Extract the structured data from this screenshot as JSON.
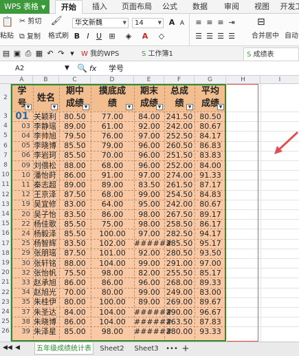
{
  "app": {
    "title": "WPS 表格"
  },
  "menu": {
    "tabs": [
      "开始",
      "插入",
      "页面布局",
      "公式",
      "数据",
      "审阅",
      "视图",
      "开发工"
    ]
  },
  "ribbon": {
    "cut": "剪切",
    "paste": "粘贴",
    "copy": "复制",
    "format_painter": "格式刷",
    "font_name": "华文新魏",
    "font_size": "14",
    "merge_center": "合并居中",
    "auto": "自动"
  },
  "quickbar": {
    "doc_tabs": [
      "我的WPS",
      "工作簿1",
      "成绩表Excel.xls"
    ]
  },
  "formula_bar": {
    "cell_ref": "A2",
    "fx": "fx",
    "content": "学号"
  },
  "columns": [
    "A",
    "B",
    "C",
    "D",
    "E",
    "F",
    "G",
    "H",
    "I"
  ],
  "table": {
    "headers": [
      {
        "line1": "学",
        "line2": "号"
      },
      {
        "line1": "姓名",
        "line2": ""
      },
      {
        "line1": "期中",
        "line2": "成绩"
      },
      {
        "line1": "摸底成",
        "line2": "绩"
      },
      {
        "line1": "期末",
        "line2": "成绩"
      },
      {
        "line1": "总成",
        "line2": "绩"
      },
      {
        "line1": "平均",
        "line2": "成绩"
      }
    ],
    "header_row_label": "2",
    "rows": [
      {
        "r": "3",
        "no": "01",
        "name": "关颖利",
        "c": "80.50",
        "d": "77.00",
        "e": "84.00",
        "f": "241.50",
        "g": "80.50"
      },
      {
        "r": "4",
        "no": "03",
        "name": "李静瑶",
        "c": "89.00",
        "d": "61.00",
        "e": "92.00",
        "f": "242.00",
        "g": "80.67"
      },
      {
        "r": "5",
        "no": "04",
        "name": "李帅旭",
        "c": "79.50",
        "d": "76.00",
        "e": "97.00",
        "f": "252.50",
        "g": "84.17"
      },
      {
        "r": "6",
        "no": "05",
        "name": "李晓博",
        "c": "85.50",
        "d": "79.00",
        "e": "96.00",
        "f": "260.50",
        "g": "86.83"
      },
      {
        "r": "7",
        "no": "06",
        "name": "李岩珂",
        "c": "85.50",
        "d": "70.00",
        "e": "96.00",
        "f": "251.50",
        "g": "83.83"
      },
      {
        "r": "8",
        "no": "09",
        "name": "刘偎松",
        "c": "88.00",
        "d": "68.00",
        "e": "96.00",
        "f": "252.00",
        "g": "84.00"
      },
      {
        "r": "10",
        "no": "10",
        "name": "潘怡莳",
        "c": "86.00",
        "d": "91.00",
        "e": "97.00",
        "f": "274.00",
        "g": "91.33"
      },
      {
        "r": "11",
        "no": "11",
        "name": "秦志超",
        "c": "89.00",
        "d": "89.00",
        "e": "83.50",
        "f": "261.50",
        "g": "87.17"
      },
      {
        "r": "12",
        "no": "12",
        "name": "王京泽",
        "c": "87.50",
        "d": "68.00",
        "e": "99.00",
        "f": "254.50",
        "g": "84.83"
      },
      {
        "r": "13",
        "no": "19",
        "name": "吴宜修",
        "c": "83.00",
        "d": "64.00",
        "e": "95.00",
        "f": "242.00",
        "g": "80.67"
      },
      {
        "r": "14",
        "no": "20",
        "name": "吴子怡",
        "c": "83.50",
        "d": "86.00",
        "e": "98.00",
        "f": "267.50",
        "g": "89.17"
      },
      {
        "r": "15",
        "no": "22",
        "name": "杨佳歌",
        "c": "85.50",
        "d": "75.00",
        "e": "98.00",
        "f": "258.50",
        "g": "86.17"
      },
      {
        "r": "16",
        "no": "24",
        "name": "杨毅泽",
        "c": "85.50",
        "d": "100.00",
        "e": "97.00",
        "f": "282.50",
        "g": "94.17"
      },
      {
        "r": "17",
        "no": "25",
        "name": "杨智辉",
        "c": "83.50",
        "d": "102.00",
        "e": "######",
        "f": "285.50",
        "g": "95.17"
      },
      {
        "r": "18",
        "no": "29",
        "name": "张朋瑶",
        "c": "87.50",
        "d": "101.00",
        "e": "92.00",
        "f": "280.50",
        "g": "93.50"
      },
      {
        "r": "19",
        "no": "30",
        "name": "张轩铭",
        "c": "88.00",
        "d": "104.00",
        "e": "99.00",
        "f": "291.00",
        "g": "97.00"
      },
      {
        "r": "20",
        "no": "32",
        "name": "张怡帆",
        "c": "75.50",
        "d": "98.00",
        "e": "82.00",
        "f": "255.50",
        "g": "85.17"
      },
      {
        "r": "21",
        "no": "33",
        "name": "赵承旭",
        "c": "86.00",
        "d": "86.00",
        "e": "96.00",
        "f": "268.00",
        "g": "89.33"
      },
      {
        "r": "22",
        "no": "34",
        "name": "赵旭光",
        "c": "70.00",
        "d": "80.00",
        "e": "99.00",
        "f": "249.00",
        "g": "83.00"
      },
      {
        "r": "23",
        "no": "35",
        "name": "朱桂伊",
        "c": "80.00",
        "d": "100.00",
        "e": "89.00",
        "f": "269.00",
        "g": "89.67"
      },
      {
        "r": "24",
        "no": "37",
        "name": "朱圣达",
        "c": "84.00",
        "d": "104.00",
        "e": "######",
        "f": "290.00",
        "g": "96.67"
      },
      {
        "r": "25",
        "no": "38",
        "name": "朱晓博",
        "c": "86.00",
        "d": "104.00",
        "e": "######",
        "f": "263.50",
        "g": "87.83"
      },
      {
        "r": "26",
        "no": "39",
        "name": "朱泽星",
        "c": "85.00",
        "d": "98.00",
        "e": "######",
        "f": "280.00",
        "g": "93.33"
      }
    ]
  },
  "sheets": {
    "tabs": [
      "五年级成绩统计表",
      "Sheet2",
      "Sheet3"
    ],
    "more": "•••",
    "add": "+"
  },
  "colors": {
    "accent": "#3c9a3c",
    "cell_fill": "#f8c9a4",
    "border": "#2d8a2d",
    "annotation": "#e05050"
  }
}
